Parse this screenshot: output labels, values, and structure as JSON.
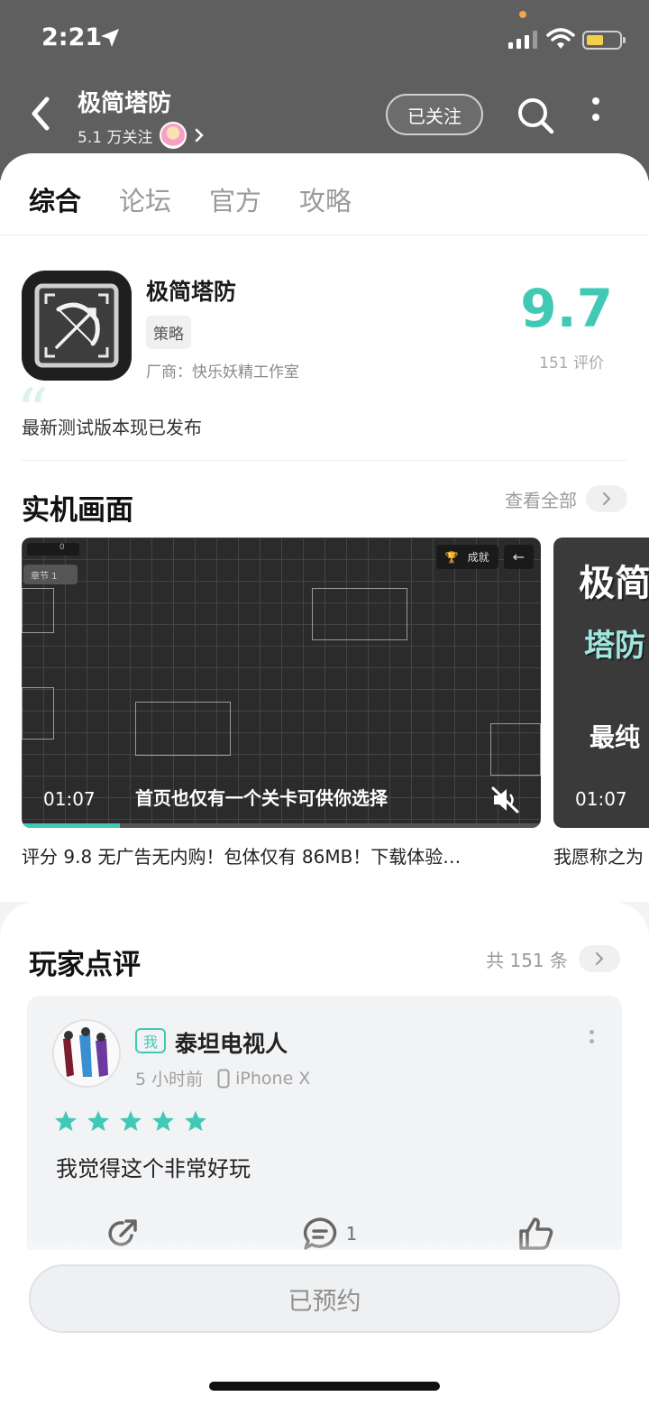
{
  "status": {
    "time": "2:21"
  },
  "header": {
    "title": "极简塔防",
    "followers": "5.1 万关注",
    "follow_label": "已关注"
  },
  "tabs": [
    "综合",
    "论坛",
    "官方",
    "攻略"
  ],
  "app": {
    "name": "极简塔防",
    "tag": "策略",
    "vendor": "厂商：快乐妖精工作室",
    "score": "9.7",
    "rating_count": "151 评价",
    "notice": "最新测试版本现已发布"
  },
  "screenshots": {
    "title": "实机画面",
    "see_all": "查看全部",
    "items": [
      {
        "duration": "01:07",
        "subtitle": "首页也仅有一个关卡可供你选择",
        "caption": "评分 9.8 无广告无内购！包体仅有 86MB！下载体验…",
        "progress": 0.19,
        "achievements_label": "成就",
        "chapter_label": "章节 1",
        "counter": "0"
      },
      {
        "duration": "01:07",
        "overlay_title_1": "极简",
        "overlay_title_2": "塔防",
        "overlay_title_3": "最纯",
        "caption": "我愿称之为"
      }
    ]
  },
  "reviews": {
    "title": "玩家点评",
    "total": "共 151 条",
    "items": [
      {
        "me_tag": "我",
        "name": "泰坦电视人",
        "time": "5 小时前",
        "device": "iPhone X",
        "rating": 5,
        "text": "我觉得这个非常好玩",
        "comment_count": "1"
      }
    ]
  },
  "bottom": {
    "reserve_label": "已预约"
  },
  "colors": {
    "accent": "#41c9b6",
    "header_bg": "#5f5f5f"
  }
}
